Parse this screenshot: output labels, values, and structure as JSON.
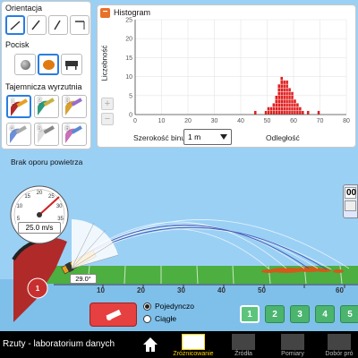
{
  "orientation": {
    "title": "Orientacja"
  },
  "projectile": {
    "title": "Pocisk"
  },
  "mystery": {
    "title": "Tajemnicza wyrzutnia",
    "numbers": [
      "1",
      "2",
      "3",
      "4",
      "5",
      "6"
    ]
  },
  "air": {
    "label": "Brak oporu powietrza"
  },
  "histogram": {
    "title": "Histogram",
    "collapse_symbol": "−",
    "ylabel": "Liczebność",
    "xlabel": "Odległość",
    "bin_label": "Szerokość binu",
    "bin_value": "1 m",
    "zoom_in": "+",
    "zoom_out": "−"
  },
  "chart_data": {
    "type": "bar",
    "xlabel": "Odległość",
    "ylabel": "Liczebność",
    "xlim": [
      0,
      80
    ],
    "ylim": [
      0,
      25
    ],
    "xticks": [
      "0",
      "10",
      "20",
      "30",
      "40",
      "50",
      "60",
      "70",
      "80"
    ],
    "yticks": [
      "0",
      "5",
      "10",
      "15",
      "20",
      "25"
    ],
    "grid": true,
    "bin_width": 1,
    "color": "#e02020",
    "bins": [
      {
        "x": 45,
        "count": 1
      },
      {
        "x": 49,
        "count": 1
      },
      {
        "x": 50,
        "count": 2
      },
      {
        "x": 51,
        "count": 2
      },
      {
        "x": 52,
        "count": 3
      },
      {
        "x": 53,
        "count": 5
      },
      {
        "x": 54,
        "count": 8
      },
      {
        "x": 55,
        "count": 10
      },
      {
        "x": 56,
        "count": 9
      },
      {
        "x": 57,
        "count": 9
      },
      {
        "x": 58,
        "count": 7
      },
      {
        "x": 59,
        "count": 6
      },
      {
        "x": 60,
        "count": 4
      },
      {
        "x": 61,
        "count": 3
      },
      {
        "x": 62,
        "count": 2
      },
      {
        "x": 63,
        "count": 1
      },
      {
        "x": 65,
        "count": 1
      },
      {
        "x": 69,
        "count": 1
      }
    ]
  },
  "launcher": {
    "speed": "25.0 m/s",
    "angle": "29.0°",
    "speed_ticks": [
      "0",
      "5",
      "10",
      "15",
      "20",
      "25",
      "30",
      "35"
    ],
    "height_badge": "1"
  },
  "ruler": {
    "numbers": [
      "10",
      "20",
      "30",
      "40",
      "50",
      "60"
    ]
  },
  "timer": {
    "value": "00"
  },
  "fire_mode": {
    "single": "Pojedynczo",
    "continuous": "Ciągłe"
  },
  "levels": [
    "1",
    "2",
    "3",
    "4",
    "5"
  ],
  "nav": {
    "app_title": "Rzuty - laboratorium danych",
    "tabs": [
      "Zróżnicowanie",
      "Źródła",
      "Pomiary",
      "Dobór pró"
    ]
  }
}
